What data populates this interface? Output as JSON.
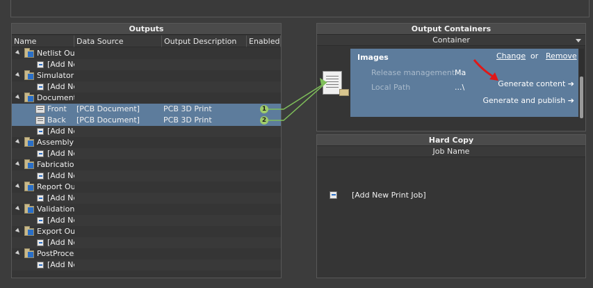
{
  "outputs": {
    "title": "Outputs",
    "columns": [
      "Name",
      "Data Source",
      "Output Description",
      "Enabled"
    ],
    "rows": [
      {
        "type": "group",
        "name": "Netlist Outputs"
      },
      {
        "type": "add",
        "name": "[Add New Netlist Output]"
      },
      {
        "type": "group",
        "name": "Simulator Outputs"
      },
      {
        "type": "add",
        "name": "[Add New Simulator Output]"
      },
      {
        "type": "group",
        "name": "Documentation Outputs"
      },
      {
        "type": "item",
        "name": "Front",
        "source": "[PCB Document]",
        "desc": "PCB 3D Print",
        "badge": "1"
      },
      {
        "type": "item",
        "name": "Back",
        "source": "[PCB Document]",
        "desc": "PCB 3D Print",
        "badge": "2"
      },
      {
        "type": "add",
        "name": "[Add New Documentation Output]"
      },
      {
        "type": "group",
        "name": "Assembly Outputs"
      },
      {
        "type": "add",
        "name": "[Add New Assembly Output]"
      },
      {
        "type": "group",
        "name": "Fabrication Outputs"
      },
      {
        "type": "add",
        "name": "[Add New Fabrication Output]"
      },
      {
        "type": "group",
        "name": "Report Outputs"
      },
      {
        "type": "add",
        "name": "[Add New Report Output]"
      },
      {
        "type": "group",
        "name": "Validation Outputs"
      },
      {
        "type": "add",
        "name": "[Add New Validation Output]"
      },
      {
        "type": "group",
        "name": "Export Outputs"
      },
      {
        "type": "add",
        "name": "[Add New Export Output]"
      },
      {
        "type": "group",
        "name": "PostProcess Outputs"
      },
      {
        "type": "add",
        "name": "[Add New PostProcess Output]"
      }
    ]
  },
  "containers": {
    "title": "Output Containers",
    "column": "Container",
    "item": {
      "name": "Images",
      "change": "Change",
      "or": "or",
      "remove": "Remove",
      "release_label": "Release management",
      "release_value": "Ma",
      "path_label": "Local Path",
      "path_value": "...\\",
      "generate": "Generate content ➔",
      "generate_publish": "Generate and publish ➔"
    }
  },
  "hardcopy": {
    "title": "Hard Copy",
    "column": "Job Name",
    "add_job": "[Add New Print Job]"
  },
  "colors": {
    "selection": "#5d7c9c",
    "link_line": "#7fbf5a",
    "annotation_arrow": "#e01818"
  }
}
